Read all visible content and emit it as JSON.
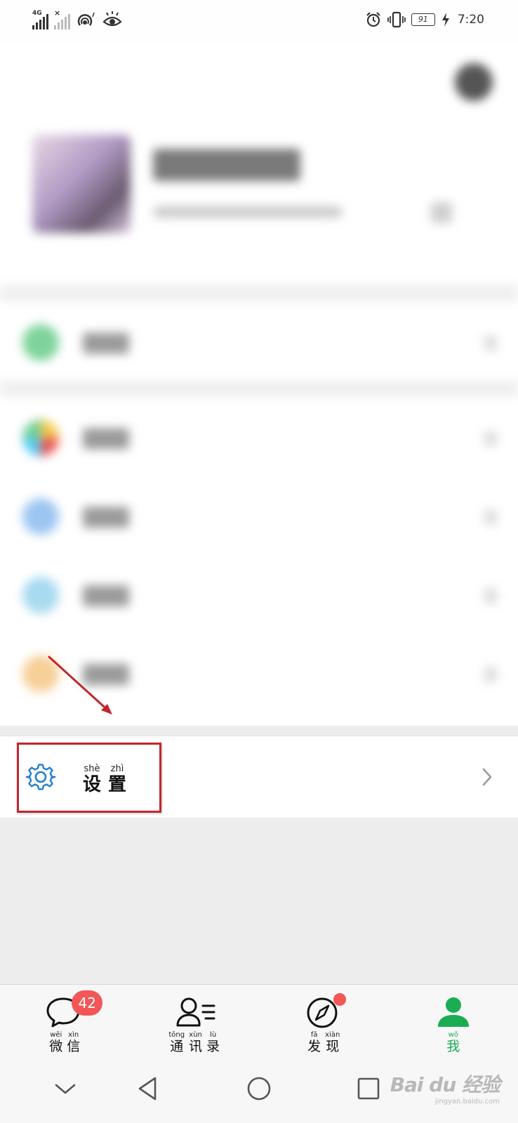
{
  "status_bar": {
    "network_label": "4G",
    "time": "7:20",
    "battery": "91",
    "icons": [
      "signal-icon",
      "no-signal-icon",
      "hotspot-icon",
      "eye-icon",
      "alarm-icon",
      "vibrate-icon",
      "battery-icon",
      "charging-icon"
    ]
  },
  "settings": {
    "pinyin": [
      "shè",
      "zhì"
    ],
    "hanzi": [
      "设",
      "置"
    ],
    "icon": "gear-icon"
  },
  "tab_bar": {
    "active_color": "#1aad53",
    "tabs": [
      {
        "id": "weixin",
        "pinyin": [
          "wēi",
          "xìn"
        ],
        "hanzi": [
          "微",
          "信"
        ],
        "badge": "42"
      },
      {
        "id": "contacts",
        "pinyin": [
          "tōng",
          "xùn",
          "lù"
        ],
        "hanzi": [
          "通",
          "讯",
          "录"
        ]
      },
      {
        "id": "discover",
        "pinyin": [
          "fā",
          "xiàn"
        ],
        "hanzi": [
          "发",
          "现"
        ]
      },
      {
        "id": "me",
        "pinyin": [
          "wǒ"
        ],
        "hanzi": [
          "我"
        ]
      }
    ]
  },
  "watermark": {
    "logo": "Bai du 经验",
    "url": "jingyan.baidu.com"
  },
  "colors": {
    "highlight": "#c0272d",
    "badge": "#f25656",
    "gear": "#1f7fd1"
  }
}
